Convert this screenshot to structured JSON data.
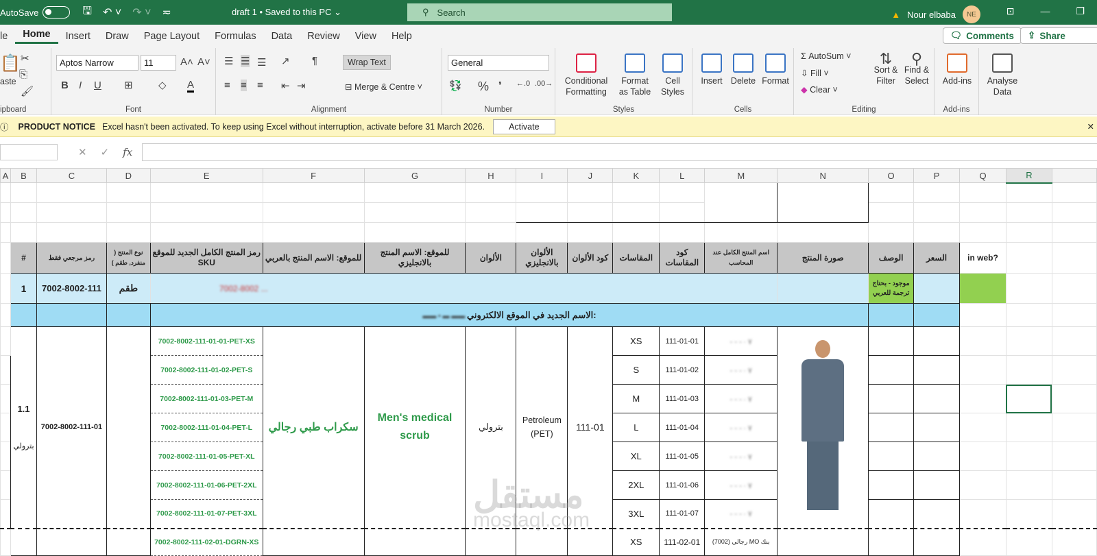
{
  "titlebar": {
    "autosave": "AutoSave",
    "doc_title": "draft 1 • Saved to this PC ⌄",
    "search": "Search",
    "user": "Nour elbaba",
    "initials": "NE"
  },
  "tabs": [
    "le",
    "Home",
    "Insert",
    "Draw",
    "Page Layout",
    "Formulas",
    "Data",
    "Review",
    "View",
    "Help"
  ],
  "comments": "Comments",
  "share": "Share",
  "ribbon": {
    "paste": "aste",
    "clipboard": "ipboard",
    "font_name": "Aptos Narrow",
    "font_size": "11",
    "font": "Font",
    "wrap": "Wrap Text",
    "merge": "Merge & Centre",
    "alignment": "Alignment",
    "number_format": "General",
    "number": "Number",
    "cond": "Conditional Formatting",
    "fmt_table": "Format as Table",
    "cell_styles": "Cell Styles",
    "styles": "Styles",
    "insert": "Insert",
    "delete": "Delete",
    "format": "Format",
    "cells": "Cells",
    "autosum": "AutoSum",
    "fill": "Fill",
    "clear": "Clear",
    "sort": "Sort & Filter",
    "find": "Find & Select",
    "editing": "Editing",
    "addins": "Add-ins",
    "addins_grp": "Add-ins",
    "analyse": "Analyse Data"
  },
  "notice": {
    "title": "PRODUCT NOTICE",
    "text": "Excel hasn't been activated. To keep using Excel without interruption, activate before 31 March 2026.",
    "button": "Activate"
  },
  "columns": [
    "A",
    "B",
    "C",
    "D",
    "E",
    "F",
    "G",
    "H",
    "I",
    "J",
    "K",
    "L",
    "M",
    "N",
    "O",
    "P",
    "Q",
    "R"
  ],
  "headers": {
    "num": "#",
    "ref": "رمز مرجعي فقط",
    "type": "نوع المنتج ( منفرد, طقم )",
    "sku": "رمز المنتج الكامل الجديد للموقع SKU",
    "name_ar": "للموقع: الاسم المنتج بالعربي",
    "name_en": "للموقع: الاسم المنتج بالانجليزي",
    "colors": "الألوان",
    "colors_en": "الألوان بالانجليزي",
    "color_code": "كود الألوان",
    "sizes": "المقاسات",
    "size_code": "كود المقاسات",
    "full_name": "اسم المنتج الكامل عند المحاسب",
    "image": "صورة المنتج",
    "desc": "الوصف",
    "price": "السعر",
    "in_web": "in web?"
  },
  "product": {
    "num": "1",
    "ref": "7002-8002-111",
    "type": "طقم",
    "blurred": "7002-8002 ...",
    "desc": "موجود - بحتاج ترجمة للعربي",
    "new_name_label": "الاسم الجديد في الموقع الالكتروني:"
  },
  "variant": {
    "num": "1.1",
    "color_label": "بترولي",
    "ref": "7002-8002-111-01",
    "name_ar": "سكراب طبي رجالي",
    "name_en": "Men's medical scrub",
    "color": "بترولي",
    "color_en": "Petroleum (PET)",
    "color_code": "111-01",
    "rows": [
      {
        "sku": "7002-8002-111-01-01-PET-XS",
        "size": "XS",
        "code": "111-01-01"
      },
      {
        "sku": "7002-8002-111-01-02-PET-S",
        "size": "S",
        "code": "111-01-02"
      },
      {
        "sku": "7002-8002-111-01-03-PET-M",
        "size": "M",
        "code": "111-01-03"
      },
      {
        "sku": "7002-8002-111-01-04-PET-L",
        "size": "L",
        "code": "111-01-04"
      },
      {
        "sku": "7002-8002-111-01-05-PET-XL",
        "size": "XL",
        "code": "111-01-05"
      },
      {
        "sku": "7002-8002-111-01-06-PET-2XL",
        "size": "2XL",
        "code": "111-01-06"
      },
      {
        "sku": "7002-8002-111-01-07-PET-3XL",
        "size": "3XL",
        "code": "111-01-07"
      }
    ]
  },
  "next_row": {
    "sku": "7002-8002-111-02-01-DGRN-XS",
    "size": "XS",
    "code": "111-02-01",
    "full_name": "(7002) رجالي MO بنك"
  },
  "watermark": {
    "ar": "مستقل",
    "en": "mostaql.com"
  }
}
